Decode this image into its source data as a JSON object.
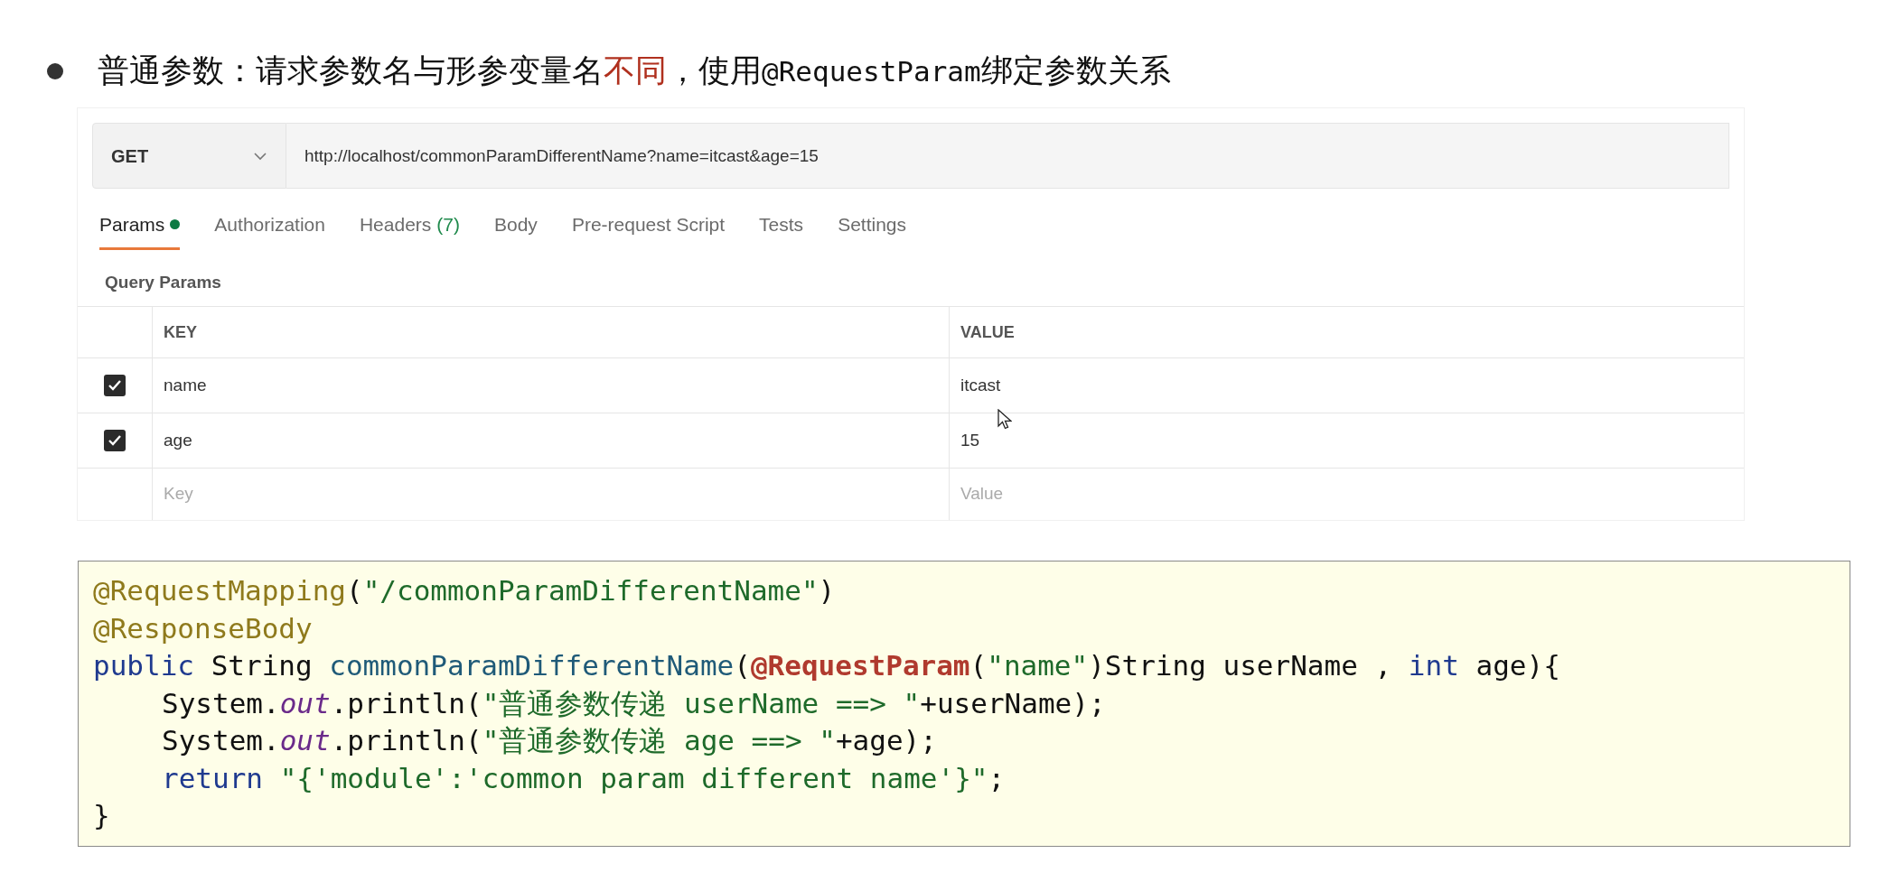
{
  "heading": {
    "segments": [
      {
        "kind": "plain",
        "text": "普通参数：请求参数名与形参变量名"
      },
      {
        "kind": "emphasis",
        "text": "不同"
      },
      {
        "kind": "plain",
        "text": "，使用"
      },
      {
        "kind": "code",
        "text": "@RequestParam"
      },
      {
        "kind": "plain",
        "text": "绑定参数关系"
      }
    ]
  },
  "request": {
    "method": "GET",
    "url": "http://localhost/commonParamDifferentName?name=itcast&age=15"
  },
  "tabs": [
    {
      "label": "Params",
      "has_dot": true,
      "selected": true
    },
    {
      "label": "Authorization",
      "has_dot": false,
      "selected": false
    },
    {
      "label": "Headers",
      "count": "(7)",
      "has_dot": false,
      "selected": false
    },
    {
      "label": "Body",
      "has_dot": false,
      "selected": false
    },
    {
      "label": "Pre-request Script",
      "has_dot": false,
      "selected": false
    },
    {
      "label": "Tests",
      "has_dot": false,
      "selected": false
    },
    {
      "label": "Settings",
      "has_dot": false,
      "selected": false
    }
  ],
  "query_params": {
    "title": "Query Params",
    "columns": [
      "KEY",
      "VALUE"
    ],
    "rows": [
      {
        "checked": true,
        "key": "name",
        "value": "itcast"
      },
      {
        "checked": true,
        "key": "age",
        "value": "15"
      }
    ],
    "new_row": {
      "key_placeholder": "Key",
      "value_placeholder": "Value"
    }
  },
  "code": {
    "lines": [
      {
        "indented": false,
        "tokens": [
          {
            "kind": "annotation",
            "text": "@RequestMapping"
          },
          {
            "kind": "plain",
            "text": "("
          },
          {
            "kind": "string",
            "text": "\"/commonParamDifferentName\""
          },
          {
            "kind": "plain",
            "text": ")"
          }
        ]
      },
      {
        "indented": false,
        "tokens": [
          {
            "kind": "annotation",
            "text": "@ResponseBody"
          }
        ]
      },
      {
        "indented": false,
        "tokens": [
          {
            "kind": "keyword",
            "text": "public"
          },
          {
            "kind": "plain",
            "text": " String "
          },
          {
            "kind": "method",
            "text": "commonParamDifferentName"
          },
          {
            "kind": "plain",
            "text": "("
          },
          {
            "kind": "param_annotation",
            "text": "@RequestParam"
          },
          {
            "kind": "plain",
            "text": "("
          },
          {
            "kind": "string",
            "text": "\"name\""
          },
          {
            "kind": "plain",
            "text": ")String userName , "
          },
          {
            "kind": "keyword",
            "text": "int"
          },
          {
            "kind": "plain",
            "text": " age){"
          }
        ]
      },
      {
        "indented": true,
        "tokens": [
          {
            "kind": "plain",
            "text": "System."
          },
          {
            "kind": "field",
            "text": "out"
          },
          {
            "kind": "plain",
            "text": ".println("
          },
          {
            "kind": "string",
            "text": "\"普通参数传递 userName ==> \""
          },
          {
            "kind": "plain",
            "text": "+userName);"
          }
        ]
      },
      {
        "indented": true,
        "tokens": [
          {
            "kind": "plain",
            "text": "System."
          },
          {
            "kind": "field",
            "text": "out"
          },
          {
            "kind": "plain",
            "text": ".println("
          },
          {
            "kind": "string",
            "text": "\"普通参数传递 age ==> \""
          },
          {
            "kind": "plain",
            "text": "+age);"
          }
        ]
      },
      {
        "indented": true,
        "tokens": [
          {
            "kind": "keyword",
            "text": "return"
          },
          {
            "kind": "string",
            "text": " \"{'module':'common param different name'}\""
          },
          {
            "kind": "plain",
            "text": ";"
          }
        ]
      },
      {
        "indented": false,
        "tokens": [
          {
            "kind": "plain",
            "text": "}"
          }
        ]
      }
    ]
  }
}
